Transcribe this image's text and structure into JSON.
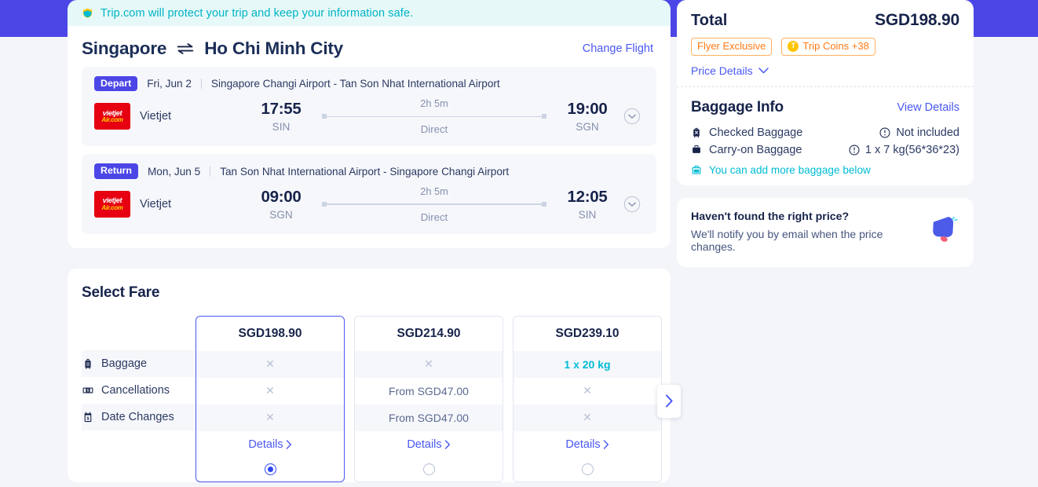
{
  "theme": {
    "brand_purple": "#4c46e6",
    "link_blue": "#4a58f2",
    "teal": "#00bcd4",
    "orange": "#ff7a16",
    "page_bg": "#f4f5f9"
  },
  "banner": {
    "icon": "shield-check-icon",
    "text": "Trip.com will protect your trip and keep your information safe."
  },
  "flight": {
    "origin": "Singapore",
    "swap_icon": "swap-arrows-icon",
    "destination": "Ho Chi Minh City",
    "change_flight_label": "Change Flight",
    "legs": [
      {
        "tag": "Depart",
        "date": "Fri, Jun 2",
        "airports": "Singapore Changi Airport - Tan Son Nhat International Airport",
        "airline": "Vietjet",
        "logo_line1": "vietjet",
        "logo_line2": "Air.com",
        "depart_time": "17:55",
        "depart_code": "SIN",
        "duration": "2h 5m",
        "stops": "Direct",
        "arrive_time": "19:00",
        "arrive_code": "SGN",
        "expand_icon": "chevron-down-circle-icon"
      },
      {
        "tag": "Return",
        "date": "Mon, Jun 5",
        "airports": "Tan Son Nhat International Airport - Singapore Changi Airport",
        "airline": "Vietjet",
        "logo_line1": "vietjet",
        "logo_line2": "Air.com",
        "depart_time": "09:00",
        "depart_code": "SGN",
        "duration": "2h 5m",
        "stops": "Direct",
        "arrive_time": "12:05",
        "arrive_code": "SIN",
        "expand_icon": "chevron-down-circle-icon"
      }
    ]
  },
  "select_fare": {
    "title": "Select Fare",
    "rows": [
      {
        "icon": "suitcase-icon",
        "label": "Baggage"
      },
      {
        "icon": "ticket-money-icon",
        "label": "Cancellations"
      },
      {
        "icon": "calendar-money-icon",
        "label": "Date Changes"
      }
    ],
    "details_label": "Details",
    "next_icon": "chevron-right-icon",
    "columns": [
      {
        "price": "SGD198.90",
        "selected": true,
        "cells": [
          {
            "type": "cross",
            "text": "✕"
          },
          {
            "type": "cross",
            "text": "✕"
          },
          {
            "type": "cross",
            "text": "✕"
          }
        ]
      },
      {
        "price": "SGD214.90",
        "selected": false,
        "cells": [
          {
            "type": "cross",
            "text": "✕"
          },
          {
            "type": "text",
            "text": "From SGD47.00"
          },
          {
            "type": "text",
            "text": "From SGD47.00"
          }
        ]
      },
      {
        "price": "SGD239.10",
        "selected": false,
        "cells": [
          {
            "type": "ok",
            "text": "1 x 20 kg"
          },
          {
            "type": "cross",
            "text": "✕"
          },
          {
            "type": "cross",
            "text": "✕"
          }
        ]
      }
    ]
  },
  "summary": {
    "total_label": "Total",
    "total_value": "SGD198.90",
    "badges": [
      {
        "label": "Flyer Exclusive",
        "icon": null
      },
      {
        "label": "Trip Coins +38",
        "icon": "trip-coin-icon",
        "coin_letter": "T"
      }
    ],
    "price_details_label": "Price Details",
    "price_details_icon": "chevron-down-icon"
  },
  "baggage": {
    "title": "Baggage Info",
    "view_details_label": "View Details",
    "rows": [
      {
        "icon": "checked-baggage-icon",
        "label": "Checked Baggage",
        "value_icon": "info-icon",
        "value": "Not included"
      },
      {
        "icon": "carry-on-baggage-icon",
        "label": "Carry-on Baggage",
        "value_icon": "info-icon",
        "value": "1 x 7 kg(56*36*23)"
      }
    ],
    "note_icon": "add-baggage-icon",
    "note": "You can add more baggage below"
  },
  "notify": {
    "title": "Haven't found the right price?",
    "subtitle": "We'll notify you by email when the price changes.",
    "icon": "bell-icon"
  }
}
